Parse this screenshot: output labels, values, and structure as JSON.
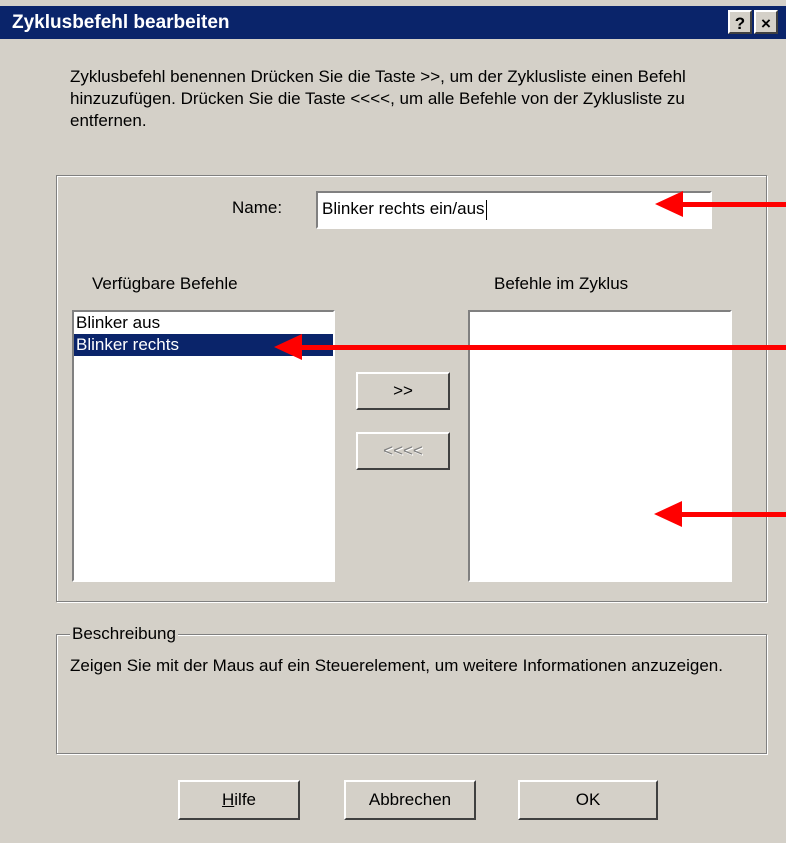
{
  "dialog": {
    "title": "Zyklusbefehl bearbeiten",
    "help_button": "?",
    "close_button": "×",
    "instructions": "Zyklusbefehl benennen Drücken Sie die Taste >>, um der Zyklusliste einen Befehl hinzuzufügen. Drücken Sie die Taste <<<<, um alle Befehle von der Zyklusliste zu entfernen."
  },
  "name_field": {
    "label": "Name:",
    "value": "Blinker rechts ein/aus"
  },
  "available": {
    "label": "Verfügbare Befehle",
    "items": [
      "Blinker aus",
      "Blinker rechts"
    ],
    "selected_index": 1
  },
  "in_cycle": {
    "label": "Befehle im Zyklus",
    "items": []
  },
  "buttons": {
    "add": ">>",
    "remove_all": "<<<<",
    "help": "Hilfe",
    "help_mnemonic": "H",
    "help_rest": "ilfe",
    "cancel": "Abbrechen",
    "ok": "OK"
  },
  "description": {
    "legend": "Beschreibung",
    "text": "Zeigen Sie mit der Maus auf ein Steuerelement, um weitere Informationen anzuzeigen."
  },
  "colors": {
    "titlebar": "#0a246a",
    "dialog_bg": "#d4d0c8",
    "selection": "#0a246a",
    "annotation_arrow": "#ff0000"
  }
}
